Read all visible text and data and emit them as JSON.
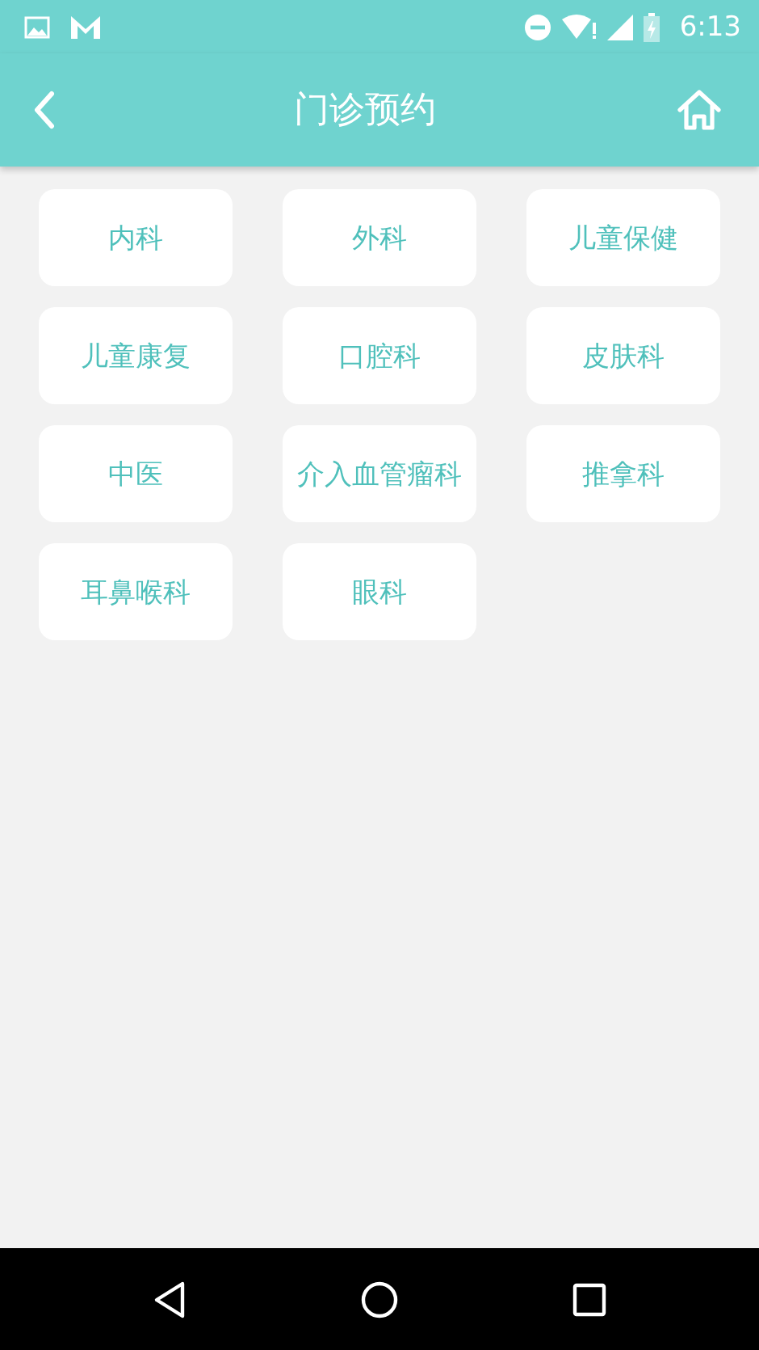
{
  "status_bar": {
    "time": "6:13"
  },
  "app_bar": {
    "title": "门诊预约"
  },
  "departments": [
    {
      "label": "内科"
    },
    {
      "label": "外科"
    },
    {
      "label": "儿童保健"
    },
    {
      "label": "儿童康复"
    },
    {
      "label": "口腔科"
    },
    {
      "label": "皮肤科"
    },
    {
      "label": "中医"
    },
    {
      "label": "介入血管瘤科"
    },
    {
      "label": "推拿科"
    },
    {
      "label": "耳鼻喉科"
    },
    {
      "label": "眼科"
    }
  ]
}
